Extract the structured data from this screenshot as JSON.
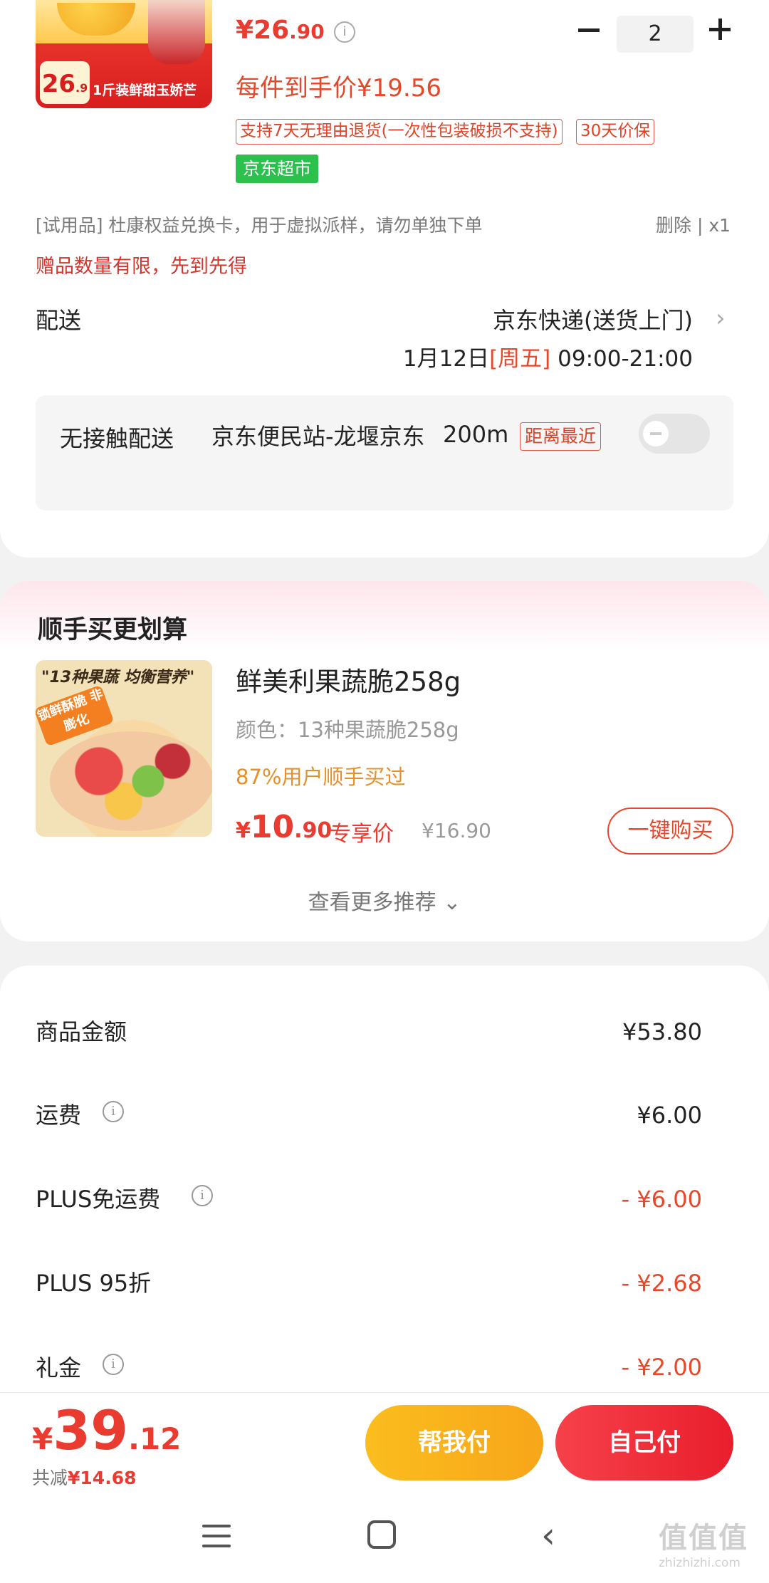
{
  "product": {
    "image_price_int": "26",
    "image_price_dec": ".9",
    "image_slogan": "1斤装鲜甜玉娇芒",
    "price_currency": "¥",
    "price_int": "26",
    "price_dec": ".90",
    "quantity": "2",
    "unit_price": "每件到手价¥19.56",
    "tags": [
      "支持7天无理由退货(一次性包装破损不支持)",
      "30天价保"
    ],
    "store_tag": "京东超市"
  },
  "gift": {
    "text": "[试用品]  杜康权益兑换卡，用于虚拟派样，请勿单独下单",
    "actions": "删除 | x1",
    "limit_note": "赠品数量有限，先到先得"
  },
  "delivery": {
    "label": "配送",
    "method": "京东快递(送货上门)",
    "date": "1月12日",
    "weekday": "[周五]",
    "time": "09:00-21:00"
  },
  "contactless": {
    "label": "无接触配送",
    "station": "京东便民站-龙堰京东",
    "distance": "200m",
    "nearest_tag": "距离最近",
    "enabled": false
  },
  "recommend": {
    "title": "顺手买更划算",
    "image_caption": "\"13种果蔬 均衡营养\"",
    "image_seal": "锁鲜酥脆 非膨化",
    "name": "鲜美利果蔬脆258g",
    "color": "颜色：13种果蔬脆258g",
    "bought_pct": "87%用户顺手买过",
    "price_currency": "¥",
    "price_int": "10",
    "price_dec": ".90",
    "exclusive_label": "专享价",
    "original_price": "¥16.90",
    "buy_button": "一键购买",
    "more_link": "查看更多推荐"
  },
  "fees": [
    {
      "label": "商品金额",
      "value": "¥53.80"
    },
    {
      "label": "运费",
      "value": "¥6.00"
    },
    {
      "label": "PLUS免运费",
      "value": "- ¥6.00"
    },
    {
      "label": "PLUS 95折",
      "value": "- ¥2.68"
    },
    {
      "label": "礼金",
      "value": "- ¥2.00"
    }
  ],
  "checkout": {
    "currency": "¥",
    "total_int": "39",
    "total_dec": ".12",
    "saved_label": "共减",
    "saved_value": "¥14.68",
    "help_pay": "帮我付",
    "self_pay": "自己付"
  },
  "watermark": {
    "main": "值值值",
    "sub": "zhizhizhi.com"
  },
  "colors": {
    "accent_red": "#e93b2f",
    "accent_orange": "#e3912c",
    "green_tag": "#2cc14d",
    "help_button": "#fbbd1e",
    "pay_button": "#e91e2c"
  }
}
